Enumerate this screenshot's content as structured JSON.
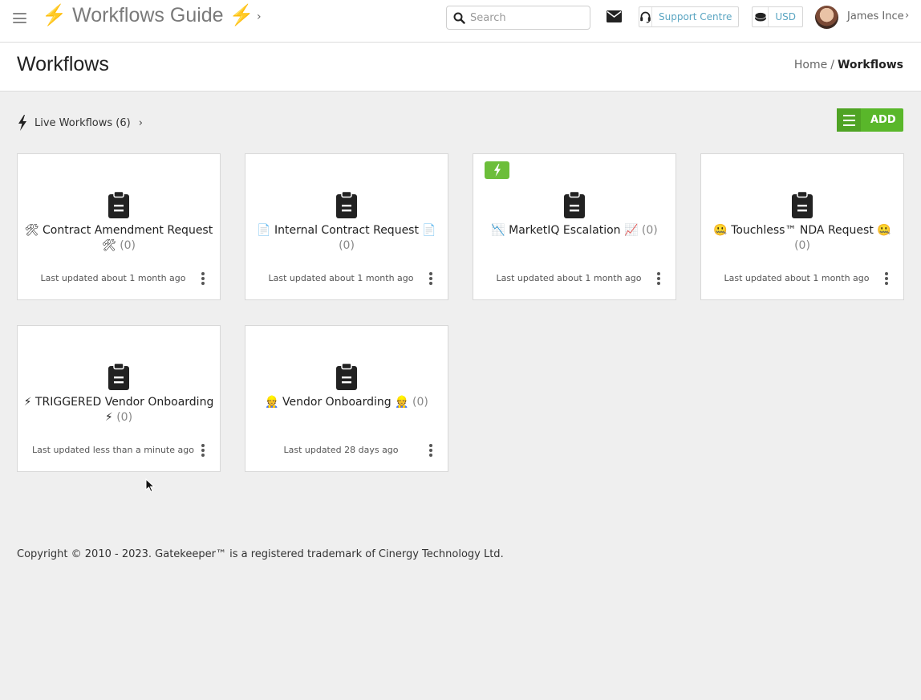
{
  "app": {
    "title_icon_left": "⚡",
    "title_text": "Workflows Guide",
    "title_icon_right": "⚡",
    "title_chevron": "›"
  },
  "search": {
    "placeholder": "Search",
    "value": ""
  },
  "topbar": {
    "support_label": "Support Centre",
    "currency_label": "USD",
    "user_name": "James Ince",
    "user_chevron": "›"
  },
  "page": {
    "title": "Workflows",
    "breadcrumb": {
      "home": "Home",
      "separator": "/",
      "current": "Workflows"
    }
  },
  "section": {
    "live_label": "Live Workflows (6)",
    "chevron": "›",
    "add_label": "ADD"
  },
  "cards": [
    {
      "prefix": "🛠",
      "name": "Contract Amendment Request",
      "suffix": "🛠",
      "count": "(0)",
      "updated": "Last updated about 1 month ago",
      "triggered_badge": false
    },
    {
      "prefix": "📄",
      "name": "Internal Contract Request",
      "suffix": "📄",
      "count": "(0)",
      "updated": "Last updated about 1 month ago",
      "triggered_badge": false
    },
    {
      "prefix": "📉",
      "name": "MarketIQ Escalation",
      "suffix": "📈",
      "count": "(0)",
      "updated": "Last updated about 1 month ago",
      "triggered_badge": true
    },
    {
      "prefix": "🤐",
      "name": "Touchless™ NDA Request",
      "suffix": "🤐",
      "count": "(0)",
      "updated": "Last updated about 1 month ago",
      "triggered_badge": false
    },
    {
      "prefix": "⚡",
      "name": "TRIGGERED Vendor Onboarding",
      "suffix": "⚡",
      "count": "(0)",
      "updated": "Last updated less than a minute ago",
      "triggered_badge": false
    },
    {
      "prefix": "👷",
      "name": "Vendor Onboarding",
      "suffix": "👷",
      "count": "(0)",
      "updated": "Last updated 28 days ago",
      "triggered_badge": false
    }
  ],
  "footer": {
    "text": "Copyright © 2010 - 2023. Gatekeeper™ is a registered trademark of Cinergy Technology Ltd."
  },
  "colors": {
    "accent_green": "#59b72a",
    "badge_green": "#6cbe3a",
    "link_blue": "#5aa5c2",
    "bolt_yellow": "#f2b600",
    "background": "#efefef"
  },
  "icons": {
    "menu": "hamburger-icon",
    "search": "search-icon",
    "mail": "envelope-icon",
    "support": "headset-icon",
    "currency": "coins-icon",
    "live": "bolt-icon",
    "card": "clipboard-icon",
    "card_menu": "kebab-menu-icon",
    "badge": "bolt-badge-icon"
  }
}
